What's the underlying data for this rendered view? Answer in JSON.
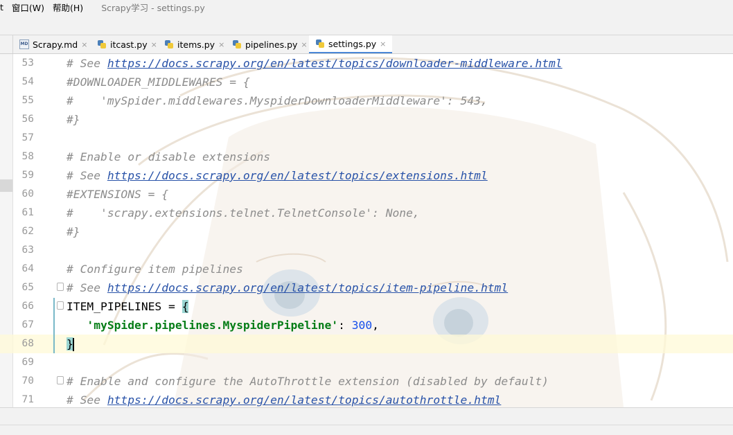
{
  "menu": {
    "items": [
      {
        "label": "t"
      },
      {
        "label": "窗口(W)"
      },
      {
        "label": "帮助(H)"
      }
    ],
    "window_title": "Scrapy学习 - settings.py"
  },
  "tabs": [
    {
      "label": "Scrapy.md",
      "icon": "markdown-file-icon",
      "icon_text": "MD",
      "active": false
    },
    {
      "label": "itcast.py",
      "icon": "python-file-icon",
      "active": false
    },
    {
      "label": "items.py",
      "icon": "python-file-icon",
      "active": false
    },
    {
      "label": "pipelines.py",
      "icon": "python-file-icon",
      "active": false
    },
    {
      "label": "settings.py",
      "icon": "python-file-icon",
      "active": true
    }
  ],
  "tab_close_glyph": "×",
  "editor": {
    "lines": [
      {
        "num": "53",
        "parts": [
          {
            "t": "# See ",
            "c": "cm"
          },
          {
            "t": "https://docs.scrapy.org/en/latest/topics/downloader-middleware.html",
            "c": "url"
          }
        ]
      },
      {
        "num": "54",
        "parts": [
          {
            "t": "#DOWNLOADER_MIDDLEWARES = {",
            "c": "cm"
          }
        ]
      },
      {
        "num": "55",
        "parts": [
          {
            "t": "#    'mySpider.middlewares.MyspiderDownloaderMiddleware': 543,",
            "c": "cm"
          }
        ]
      },
      {
        "num": "56",
        "parts": [
          {
            "t": "#}",
            "c": "cm"
          }
        ]
      },
      {
        "num": "57",
        "parts": []
      },
      {
        "num": "58",
        "parts": [
          {
            "t": "# Enable or disable extensions",
            "c": "cm"
          }
        ]
      },
      {
        "num": "59",
        "parts": [
          {
            "t": "# See ",
            "c": "cm"
          },
          {
            "t": "https://docs.scrapy.org/en/latest/topics/extensions.html",
            "c": "url"
          }
        ]
      },
      {
        "num": "60",
        "parts": [
          {
            "t": "#EXTENSIONS = {",
            "c": "cm"
          }
        ]
      },
      {
        "num": "61",
        "parts": [
          {
            "t": "#    'scrapy.extensions.telnet.TelnetConsole': None,",
            "c": "cm"
          }
        ]
      },
      {
        "num": "62",
        "parts": [
          {
            "t": "#}",
            "c": "cm"
          }
        ]
      },
      {
        "num": "63",
        "parts": []
      },
      {
        "num": "64",
        "parts": [
          {
            "t": "# Configure item pipelines",
            "c": "cm"
          }
        ]
      },
      {
        "num": "65",
        "parts": [
          {
            "t": "# See ",
            "c": "cm"
          },
          {
            "t": "https://docs.scrapy.org/en/latest/topics/item-pipeline.html",
            "c": "url"
          }
        ]
      },
      {
        "num": "66",
        "parts": [
          {
            "t": "ITEM_PIPELINES = ",
            "c": "kw"
          },
          {
            "t": "{",
            "c": "brace-hl"
          }
        ]
      },
      {
        "num": "67",
        "parts": [
          {
            "t": "   ",
            "c": "kw"
          },
          {
            "t": "'mySpider.pipelines.MyspiderPipeline'",
            "c": "str"
          },
          {
            "t": ": ",
            "c": "kw"
          },
          {
            "t": "300",
            "c": "num"
          },
          {
            "t": ",",
            "c": "kw"
          }
        ]
      },
      {
        "num": "68",
        "parts": [
          {
            "t": "}",
            "c": "brace-hl"
          }
        ],
        "current": true
      },
      {
        "num": "69",
        "parts": []
      },
      {
        "num": "70",
        "parts": [
          {
            "t": "# Enable and configure the AutoThrottle extension (disabled by default)",
            "c": "cm"
          }
        ]
      },
      {
        "num": "71",
        "parts": [
          {
            "t": "# See ",
            "c": "cm"
          },
          {
            "t": "https://docs.scrapy.org/en/latest/topics/autothrottle.html",
            "c": "url"
          }
        ]
      }
    ]
  }
}
